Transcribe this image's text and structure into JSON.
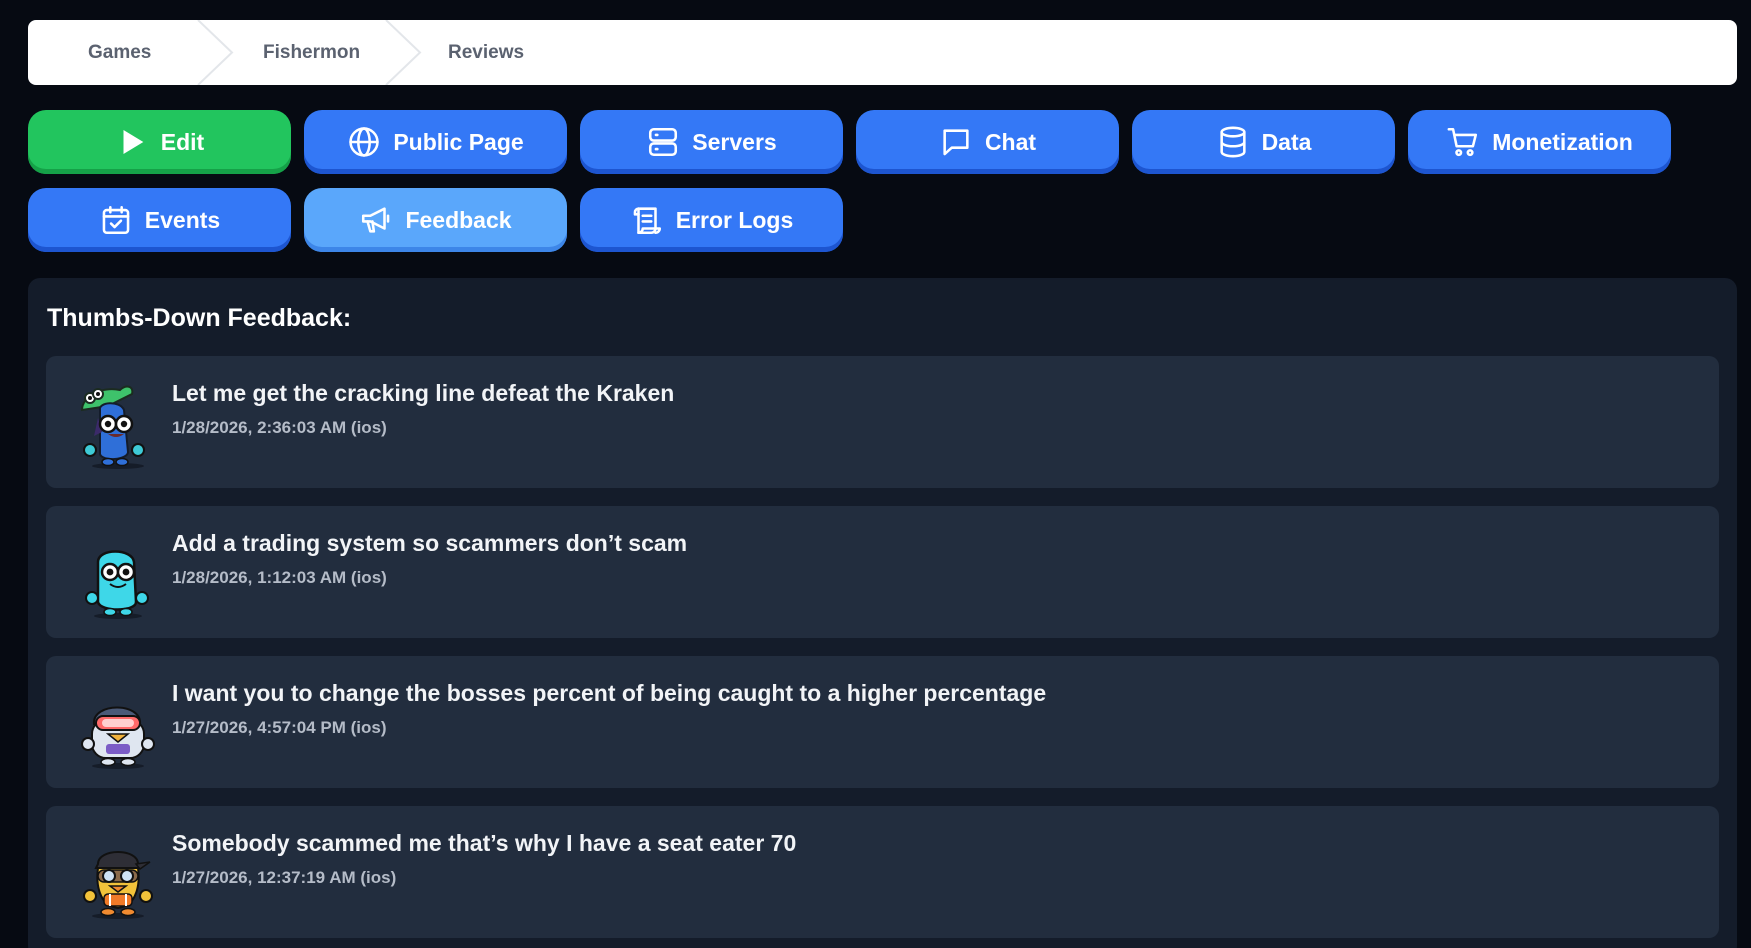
{
  "breadcrumb": [
    "Games",
    "Fishermon",
    "Reviews"
  ],
  "nav": {
    "edit": {
      "label": "Edit",
      "icon": "play-icon"
    },
    "public_page": {
      "label": "Public Page",
      "icon": "globe-icon"
    },
    "servers": {
      "label": "Servers",
      "icon": "server-icon"
    },
    "chat": {
      "label": "Chat",
      "icon": "chat-bubble-icon"
    },
    "data": {
      "label": "Data",
      "icon": "database-icon"
    },
    "monetization": {
      "label": "Monetization",
      "icon": "cart-icon"
    },
    "events": {
      "label": "Events",
      "icon": "calendar-check-icon"
    },
    "feedback": {
      "label": "Feedback",
      "icon": "megaphone-icon"
    },
    "error_logs": {
      "label": "Error Logs",
      "icon": "scroll-icon"
    }
  },
  "colors": {
    "nav_blue": "#3478f6",
    "nav_green": "#22c55e",
    "nav_active": "#5aa7fb",
    "panel": "#141c2a",
    "card": "#222d3e"
  },
  "panel": {
    "title": "Thumbs-Down Feedback:",
    "items": [
      {
        "text": "Let me get the cracking line defeat the Kraken",
        "meta": "1/28/2026, 2:36:03 AM (ios)",
        "avatar": "green-hat-blue-creature-avatar"
      },
      {
        "text": "Add a trading system so scammers don’t scam",
        "meta": "1/28/2026, 1:12:03 AM (ios)",
        "avatar": "cyan-blob-creature-avatar"
      },
      {
        "text": "I want you to change the bosses percent of being caught to a higher percentage",
        "meta": "1/27/2026, 4:57:04 PM (ios)",
        "avatar": "astronaut-goggles-avatar"
      },
      {
        "text": "Somebody scammed me that’s why I have a seat eater 70",
        "meta": "1/27/2026, 12:37:19 AM (ios)",
        "avatar": "orange-duck-goggles-avatar"
      }
    ]
  }
}
